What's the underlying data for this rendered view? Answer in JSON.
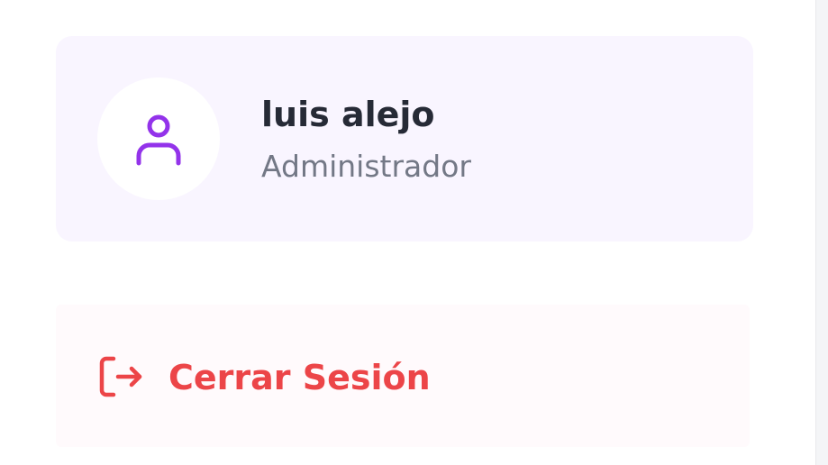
{
  "user": {
    "name": "luis alejo",
    "role": "Administrador",
    "avatar_icon": "user-icon"
  },
  "logout": {
    "label": "Cerrar Sesión",
    "icon": "logout-icon"
  },
  "colors": {
    "card_background": "#f9f5ff",
    "avatar_icon": "#9333ea",
    "name_text": "#262a36",
    "role_text": "#737886",
    "logout_text": "#ec4548",
    "logout_background": "#fffafc"
  }
}
